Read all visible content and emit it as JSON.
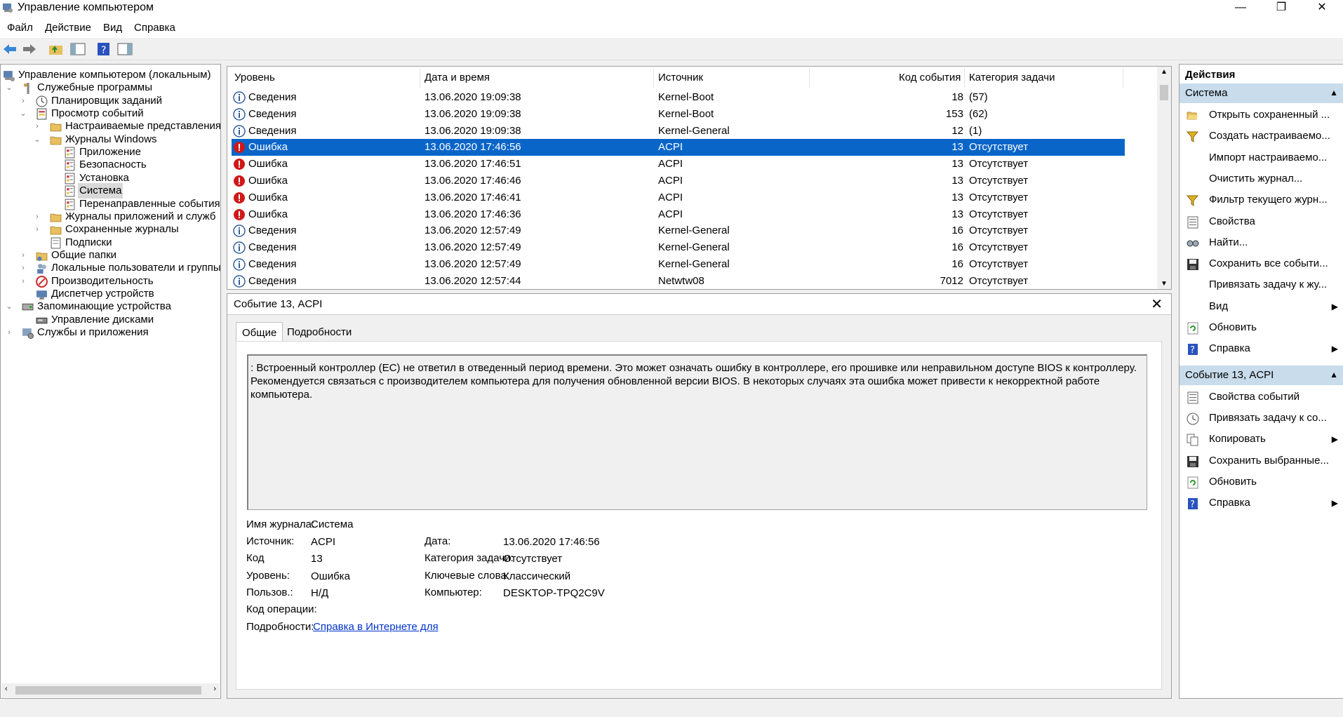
{
  "window": {
    "title": "Управление компьютером",
    "minimize": "—",
    "maximize": "❐",
    "close": "✕"
  },
  "menu": [
    "Файл",
    "Действие",
    "Вид",
    "Справка"
  ],
  "tree": [
    {
      "label": "Управление компьютером (локальным)",
      "exp": "",
      "icon": "computer-management-icon",
      "depth": 0
    },
    {
      "label": "Служебные программы",
      "exp": "⌄",
      "icon": "tools-icon",
      "depth": 1
    },
    {
      "label": "Планировщик заданий",
      "exp": "›",
      "icon": "clock-icon",
      "depth": 2
    },
    {
      "label": "Просмотр событий",
      "exp": "⌄",
      "icon": "event-viewer-icon",
      "depth": 2
    },
    {
      "label": "Настраиваемые представления",
      "exp": "›",
      "icon": "folder-icon",
      "depth": 3
    },
    {
      "label": "Журналы Windows",
      "exp": "⌄",
      "icon": "folder-icon",
      "depth": 3
    },
    {
      "label": "Приложение",
      "exp": "",
      "icon": "log-icon",
      "depth": 4
    },
    {
      "label": "Безопасность",
      "exp": "",
      "icon": "log-icon",
      "depth": 4
    },
    {
      "label": "Установка",
      "exp": "",
      "icon": "log-icon",
      "depth": 4
    },
    {
      "label": "Система",
      "exp": "",
      "icon": "log-icon",
      "depth": 4,
      "selected": true
    },
    {
      "label": "Перенаправленные события",
      "exp": "",
      "icon": "log-icon",
      "depth": 4
    },
    {
      "label": "Журналы приложений и служб",
      "exp": "›",
      "icon": "folder-icon",
      "depth": 3
    },
    {
      "label": "Сохраненные журналы",
      "exp": "›",
      "icon": "folder-icon",
      "depth": 3
    },
    {
      "label": "Подписки",
      "exp": "",
      "icon": "subscription-icon",
      "depth": 3
    },
    {
      "label": "Общие папки",
      "exp": "›",
      "icon": "shared-folder-icon",
      "depth": 2
    },
    {
      "label": "Локальные пользователи и группы",
      "exp": "›",
      "icon": "users-icon",
      "depth": 2
    },
    {
      "label": "Производительность",
      "exp": "›",
      "icon": "performance-icon",
      "depth": 2
    },
    {
      "label": "Диспетчер устройств",
      "exp": "",
      "icon": "device-manager-icon",
      "depth": 2
    },
    {
      "label": "Запоминающие устройства",
      "exp": "⌄",
      "icon": "storage-icon",
      "depth": 1
    },
    {
      "label": "Управление дисками",
      "exp": "",
      "icon": "disk-icon",
      "depth": 2
    },
    {
      "label": "Службы и приложения",
      "exp": "›",
      "icon": "services-icon",
      "depth": 1
    }
  ],
  "events": {
    "columns": [
      "Уровень",
      "Дата и время",
      "Источник",
      "Код события",
      "Категория задачи"
    ],
    "rows": [
      {
        "level": "Сведения",
        "type": "info",
        "date": "13.06.2020 19:09:38",
        "source": "Kernel-Boot",
        "code": "18",
        "category": "(57)"
      },
      {
        "level": "Сведения",
        "type": "info",
        "date": "13.06.2020 19:09:38",
        "source": "Kernel-Boot",
        "code": "153",
        "category": "(62)"
      },
      {
        "level": "Сведения",
        "type": "info",
        "date": "13.06.2020 19:09:38",
        "source": "Kernel-General",
        "code": "12",
        "category": "(1)"
      },
      {
        "level": "Ошибка",
        "type": "error",
        "date": "13.06.2020 17:46:56",
        "source": "ACPI",
        "code": "13",
        "category": "Отсутствует",
        "selected": true
      },
      {
        "level": "Ошибка",
        "type": "error",
        "date": "13.06.2020 17:46:51",
        "source": "ACPI",
        "code": "13",
        "category": "Отсутствует"
      },
      {
        "level": "Ошибка",
        "type": "error",
        "date": "13.06.2020 17:46:46",
        "source": "ACPI",
        "code": "13",
        "category": "Отсутствует"
      },
      {
        "level": "Ошибка",
        "type": "error",
        "date": "13.06.2020 17:46:41",
        "source": "ACPI",
        "code": "13",
        "category": "Отсутствует"
      },
      {
        "level": "Ошибка",
        "type": "error",
        "date": "13.06.2020 17:46:36",
        "source": "ACPI",
        "code": "13",
        "category": "Отсутствует"
      },
      {
        "level": "Сведения",
        "type": "info",
        "date": "13.06.2020 12:57:49",
        "source": "Kernel-General",
        "code": "16",
        "category": "Отсутствует"
      },
      {
        "level": "Сведения",
        "type": "info",
        "date": "13.06.2020 12:57:49",
        "source": "Kernel-General",
        "code": "16",
        "category": "Отсутствует"
      },
      {
        "level": "Сведения",
        "type": "info",
        "date": "13.06.2020 12:57:49",
        "source": "Kernel-General",
        "code": "16",
        "category": "Отсутствует"
      },
      {
        "level": "Сведения",
        "type": "info",
        "date": "13.06.2020 12:57:44",
        "source": "Netwtw08",
        "code": "7012",
        "category": "Отсутствует"
      }
    ]
  },
  "detail": {
    "title": "Событие 13, ACPI",
    "close": "✕",
    "tabs": [
      "Общие",
      "Подробности"
    ],
    "message": ": Встроенный контроллер (EC) не ответил в отведенный период времени. Это может означать ошибку в контроллере, его прошивке или неправильном доступе BIOS к контроллеру. Рекомендуется связаться с производителем компьютера для получения обновленной версии BIOS. В некоторых случаях эта ошибка может привести к некорректной работе компьютера.",
    "fields": {
      "log_label": "Имя журнала:",
      "log": "Система",
      "source_label": "Источник:",
      "source": "ACPI",
      "date_label": "Дата:",
      "date": "13.06.2020 17:46:56",
      "code_label": "Код",
      "code": "13",
      "category_label": "Категория задачи:",
      "category": "Отсутствует",
      "level_label": "Уровень:",
      "level": "Ошибка",
      "keywords_label": "Ключевые слова:",
      "keywords": "Классический",
      "user_label": "Пользов.:",
      "user": "Н/Д",
      "computer_label": "Компьютер:",
      "computer": "DESKTOP-TPQ2C9V",
      "opcode_label": "Код операции:",
      "more_label": "Подробности:",
      "more_link": "Справка в Интернете для"
    }
  },
  "actions": {
    "title": "Действия",
    "sections": [
      {
        "title": "Система",
        "items": [
          {
            "label": "Открыть сохраненный ...",
            "icon": "open-folder-icon"
          },
          {
            "label": "Создать настраиваемо...",
            "icon": "filter-icon"
          },
          {
            "label": "Импорт настраиваемо...",
            "icon": ""
          },
          {
            "label": "Очистить журнал...",
            "icon": ""
          },
          {
            "label": "Фильтр текущего журн...",
            "icon": "filter-icon"
          },
          {
            "label": "Свойства",
            "icon": "properties-icon"
          },
          {
            "label": "Найти...",
            "icon": "find-icon"
          },
          {
            "label": "Сохранить все событи...",
            "icon": "save-icon"
          },
          {
            "label": "Привязать задачу к жу...",
            "icon": ""
          },
          {
            "label": "Вид",
            "icon": "",
            "submenu": true
          },
          {
            "label": "Обновить",
            "icon": "refresh-icon"
          },
          {
            "label": "Справка",
            "icon": "help-icon",
            "submenu": true
          }
        ]
      },
      {
        "title": "Событие 13, ACPI",
        "items": [
          {
            "label": "Свойства событий",
            "icon": "properties-icon"
          },
          {
            "label": "Привязать задачу к со...",
            "icon": "task-icon"
          },
          {
            "label": "Копировать",
            "icon": "copy-icon",
            "submenu": true
          },
          {
            "label": "Сохранить выбранные...",
            "icon": "save-icon"
          },
          {
            "label": "Обновить",
            "icon": "refresh-icon"
          },
          {
            "label": "Справка",
            "icon": "help-icon",
            "submenu": true
          }
        ]
      }
    ]
  },
  "colors": {
    "selection": "#0a65c9",
    "section": "#c8dcec",
    "error": "#d01818",
    "info": "#2f5f9f"
  }
}
